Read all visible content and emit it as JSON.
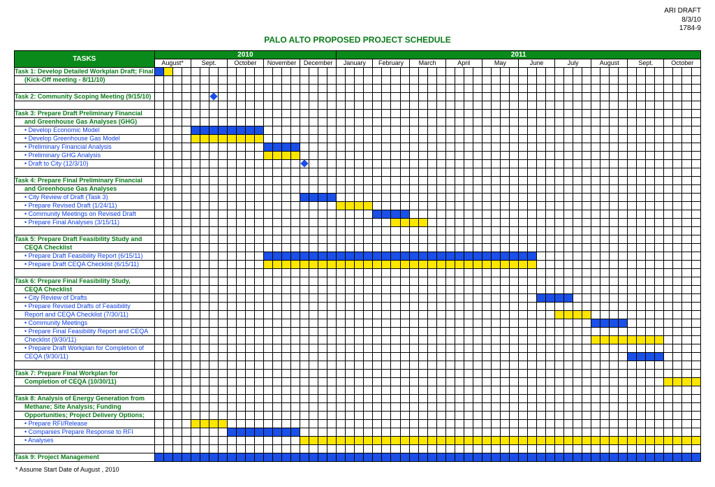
{
  "header": {
    "right1": "ARI DRAFT",
    "right2": "8/3/10",
    "right3": "1784-9"
  },
  "title": "PALO ALTO PROPOSED PROJECT SCHEDULE",
  "timeline": {
    "tasks_label": "TASKS",
    "years": [
      {
        "label": "2010",
        "months": [
          {
            "name": "August*",
            "weeks": 4
          },
          {
            "name": "Sept.",
            "weeks": 4
          },
          {
            "name": "October",
            "weeks": 4
          },
          {
            "name": "November",
            "weeks": 4
          },
          {
            "name": "December",
            "weeks": 4
          }
        ]
      },
      {
        "label": "2011",
        "months": [
          {
            "name": "January",
            "weeks": 4
          },
          {
            "name": "February",
            "weeks": 4
          },
          {
            "name": "March",
            "weeks": 4
          },
          {
            "name": "April",
            "weeks": 4
          },
          {
            "name": "May",
            "weeks": 4
          },
          {
            "name": "June",
            "weeks": 4
          },
          {
            "name": "July",
            "weeks": 4
          },
          {
            "name": "August",
            "weeks": 4
          },
          {
            "name": "Sept.",
            "weeks": 4
          },
          {
            "name": "October",
            "weeks": 4
          }
        ]
      }
    ]
  },
  "footnote": "* Assume Start Date of August , 2010",
  "rows": [
    {
      "kind": "task",
      "color": "green",
      "label": "Task 1: Develop Detailed Workplan Draft; Final",
      "bars": [
        {
          "s": 0,
          "e": 0,
          "c": "b"
        },
        {
          "s": 1,
          "e": 1,
          "c": "y"
        }
      ]
    },
    {
      "kind": "sub",
      "color": "green",
      "label": "(Kick-Off meeting - 8/11/10)"
    },
    {
      "kind": "spacer"
    },
    {
      "kind": "task",
      "color": "green",
      "label": "Task 2: Community Scoping Meeting (9/15/10)",
      "dots": [
        6
      ]
    },
    {
      "kind": "spacer"
    },
    {
      "kind": "task",
      "color": "green",
      "label": "Task 3: Prepare Draft Preliminary Financial"
    },
    {
      "kind": "sub",
      "color": "green",
      "label": "and Greenhouse Gas Analyses (GHG)"
    },
    {
      "kind": "sub",
      "color": "blue",
      "label": "• Develop Economic Model",
      "bars": [
        {
          "s": 4,
          "e": 11,
          "c": "b"
        }
      ]
    },
    {
      "kind": "sub",
      "color": "blue",
      "label": "• Develop Greenhouse Gas Model",
      "bars": [
        {
          "s": 4,
          "e": 11,
          "c": "y"
        }
      ]
    },
    {
      "kind": "sub",
      "color": "blue",
      "label": "• Preliminary Financial Analysis",
      "bars": [
        {
          "s": 12,
          "e": 15,
          "c": "b"
        }
      ]
    },
    {
      "kind": "sub",
      "color": "blue",
      "label": "• Preliminary GHG Analysis",
      "bars": [
        {
          "s": 12,
          "e": 15,
          "c": "y"
        }
      ]
    },
    {
      "kind": "sub",
      "color": "blue",
      "label": "• Draft to City (12/3/10)",
      "dots": [
        16
      ]
    },
    {
      "kind": "spacer"
    },
    {
      "kind": "task",
      "color": "green",
      "label": "Task 4: Prepare Final Preliminary Financial"
    },
    {
      "kind": "sub",
      "color": "green",
      "label": "and Greenhouse Gas Analyses"
    },
    {
      "kind": "sub",
      "color": "blue",
      "label": "• City Review of Draft (Task 3)",
      "bars": [
        {
          "s": 16,
          "e": 19,
          "c": "b"
        }
      ]
    },
    {
      "kind": "sub",
      "color": "blue",
      "label": "• Prepare Revised Draft (1/24/11)",
      "bars": [
        {
          "s": 20,
          "e": 23,
          "c": "y"
        }
      ]
    },
    {
      "kind": "sub",
      "color": "blue",
      "label": "• Community Meetings on Revised Draft",
      "bars": [
        {
          "s": 24,
          "e": 27,
          "c": "b"
        }
      ]
    },
    {
      "kind": "sub",
      "color": "blue",
      "label": "• Prepare Final Analyses (3/15/11)",
      "bars": [
        {
          "s": 26,
          "e": 29,
          "c": "y"
        }
      ]
    },
    {
      "kind": "spacer"
    },
    {
      "kind": "task",
      "color": "green",
      "label": "Task 5: Prepare Draft Feasibility Study and"
    },
    {
      "kind": "sub",
      "color": "green",
      "label": "CEQA Checklist"
    },
    {
      "kind": "sub",
      "color": "blue",
      "label": "• Prepare Draft Feasibility Report (6/15/11)",
      "bars": [
        {
          "s": 12,
          "e": 41,
          "c": "b"
        }
      ]
    },
    {
      "kind": "sub",
      "color": "blue",
      "label": "• Prepare Draft CEQA Checklist (6/15/11)",
      "bars": [
        {
          "s": 12,
          "e": 41,
          "c": "y"
        }
      ]
    },
    {
      "kind": "spacer"
    },
    {
      "kind": "task",
      "color": "green",
      "label": "Task 6: Prepare Final Feasibility Study,"
    },
    {
      "kind": "sub",
      "color": "green",
      "label": "CEQA Checklist"
    },
    {
      "kind": "sub",
      "color": "blue",
      "label": "• City Review of Drafts",
      "bars": [
        {
          "s": 42,
          "e": 45,
          "c": "b"
        }
      ]
    },
    {
      "kind": "sub",
      "color": "blue",
      "label": "• Prepare Revised Drafts of Feasibility"
    },
    {
      "kind": "sub",
      "color": "blue",
      "label": "Report and CEQA Checklist (7/30/11)",
      "bars": [
        {
          "s": 44,
          "e": 47,
          "c": "y"
        }
      ]
    },
    {
      "kind": "sub",
      "color": "blue",
      "label": "• Community Meetings",
      "bars": [
        {
          "s": 48,
          "e": 51,
          "c": "b"
        }
      ]
    },
    {
      "kind": "sub",
      "color": "blue",
      "label": "• Prepare Final Feasibility Report and CEQA"
    },
    {
      "kind": "sub",
      "color": "blue",
      "label": "Checklist (9/30/11)",
      "bars": [
        {
          "s": 48,
          "e": 55,
          "c": "y"
        }
      ]
    },
    {
      "kind": "sub",
      "color": "blue",
      "label": "• Prepare Draft Workplan for Completion of"
    },
    {
      "kind": "sub",
      "color": "blue",
      "label": "CEQA (9/30/11)",
      "bars": [
        {
          "s": 52,
          "e": 55,
          "c": "b"
        }
      ]
    },
    {
      "kind": "spacer"
    },
    {
      "kind": "task",
      "color": "green",
      "label": "Task 7: Prepare Final Workplan for"
    },
    {
      "kind": "sub",
      "color": "green",
      "label": "Completion of CEQA (10/30/11)",
      "bars": [
        {
          "s": 56,
          "e": 59,
          "c": "y"
        }
      ]
    },
    {
      "kind": "spacer"
    },
    {
      "kind": "task",
      "color": "green",
      "label": "Task 8: Analysis of Energy Generation from"
    },
    {
      "kind": "sub",
      "color": "green",
      "label": "Methane; Site Analysis; Funding"
    },
    {
      "kind": "sub",
      "color": "green",
      "label": "Opportunities; Project Delivery Options;"
    },
    {
      "kind": "sub",
      "color": "blue",
      "label": "• Prepare RFI/Release",
      "bars": [
        {
          "s": 4,
          "e": 7,
          "c": "y"
        }
      ]
    },
    {
      "kind": "sub",
      "color": "blue",
      "label": "• Companies Prepare Response to RFI",
      "bars": [
        {
          "s": 8,
          "e": 15,
          "c": "b"
        }
      ]
    },
    {
      "kind": "sub",
      "color": "blue",
      "label": "• Analyses",
      "bars": [
        {
          "s": 16,
          "e": 59,
          "c": "y"
        }
      ]
    },
    {
      "kind": "spacer"
    },
    {
      "kind": "task",
      "color": "green",
      "label": "Task 9: Project Management",
      "bars": [
        {
          "s": 0,
          "e": 59,
          "c": "b"
        }
      ]
    }
  ],
  "chart_data": {
    "type": "gantt",
    "title": "PALO ALTO PROPOSED PROJECT SCHEDULE",
    "time_unit": "week",
    "start_month": "August 2010",
    "months": [
      "Aug10",
      "Sep10",
      "Oct10",
      "Nov10",
      "Dec10",
      "Jan11",
      "Feb11",
      "Mar11",
      "Apr11",
      "May11",
      "Jun11",
      "Jul11",
      "Aug11",
      "Sep11",
      "Oct11"
    ],
    "weeks_per_month": 4,
    "series": [
      {
        "name": "Task 1: Develop Detailed Workplan Draft; Final",
        "start_week": 0,
        "end_week": 1,
        "color": "blue/yellow"
      },
      {
        "name": "Task 2: Community Scoping Meeting (9/15/10)",
        "milestone_week": 6
      },
      {
        "name": "Develop Economic Model",
        "start_week": 4,
        "end_week": 11,
        "color": "blue"
      },
      {
        "name": "Develop Greenhouse Gas Model",
        "start_week": 4,
        "end_week": 11,
        "color": "yellow"
      },
      {
        "name": "Preliminary Financial Analysis",
        "start_week": 12,
        "end_week": 15,
        "color": "blue"
      },
      {
        "name": "Preliminary GHG Analysis",
        "start_week": 12,
        "end_week": 15,
        "color": "yellow"
      },
      {
        "name": "Draft to City (12/3/10)",
        "milestone_week": 16
      },
      {
        "name": "City Review of Draft (Task 3)",
        "start_week": 16,
        "end_week": 19,
        "color": "blue"
      },
      {
        "name": "Prepare Revised Draft (1/24/11)",
        "start_week": 20,
        "end_week": 23,
        "color": "yellow"
      },
      {
        "name": "Community Meetings on Revised Draft",
        "start_week": 24,
        "end_week": 27,
        "color": "blue"
      },
      {
        "name": "Prepare Final Analyses (3/15/11)",
        "start_week": 26,
        "end_week": 29,
        "color": "yellow"
      },
      {
        "name": "Prepare Draft Feasibility Report (6/15/11)",
        "start_week": 12,
        "end_week": 41,
        "color": "blue"
      },
      {
        "name": "Prepare Draft CEQA Checklist (6/15/11)",
        "start_week": 12,
        "end_week": 41,
        "color": "yellow"
      },
      {
        "name": "City Review of Drafts",
        "start_week": 42,
        "end_week": 45,
        "color": "blue"
      },
      {
        "name": "Prepare Revised Drafts of Feasibility Report and CEQA Checklist (7/30/11)",
        "start_week": 44,
        "end_week": 47,
        "color": "yellow"
      },
      {
        "name": "Community Meetings",
        "start_week": 48,
        "end_week": 51,
        "color": "blue"
      },
      {
        "name": "Prepare Final Feasibility Report and CEQA Checklist (9/30/11)",
        "start_week": 48,
        "end_week": 55,
        "color": "yellow"
      },
      {
        "name": "Prepare Draft Workplan for Completion of CEQA (9/30/11)",
        "start_week": 52,
        "end_week": 55,
        "color": "blue"
      },
      {
        "name": "Task 7: Prepare Final Workplan for Completion of CEQA (10/30/11)",
        "start_week": 56,
        "end_week": 59,
        "color": "yellow"
      },
      {
        "name": "Prepare RFI/Release",
        "start_week": 4,
        "end_week": 7,
        "color": "yellow"
      },
      {
        "name": "Companies Prepare Response to RFI",
        "start_week": 8,
        "end_week": 15,
        "color": "blue"
      },
      {
        "name": "Analyses",
        "start_week": 16,
        "end_week": 59,
        "color": "yellow"
      },
      {
        "name": "Task 9: Project Management",
        "start_week": 0,
        "end_week": 59,
        "color": "blue"
      }
    ]
  }
}
